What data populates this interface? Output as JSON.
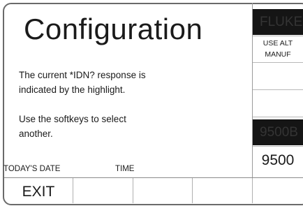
{
  "screen": {
    "title": "Configuration",
    "message_line1": "The current *IDN? response is",
    "message_line2": "indicated by the highlight.",
    "message_line3": "Use the softkeys to select",
    "message_line4": "another.",
    "date_label": "TODAY'S DATE",
    "time_label": "TIME"
  },
  "right_softkeys": [
    {
      "label": "FLUKE",
      "selected": true
    },
    {
      "label": "USE ALT",
      "label2": "MANUF"
    },
    {
      "label": ""
    },
    {
      "label": ""
    },
    {
      "label": "9500B",
      "selected": true
    },
    {
      "label": "9500"
    }
  ],
  "bottom_softkeys": [
    {
      "label": "EXIT"
    },
    {
      "label": ""
    },
    {
      "label": ""
    },
    {
      "label": ""
    },
    {
      "label": ""
    }
  ]
}
